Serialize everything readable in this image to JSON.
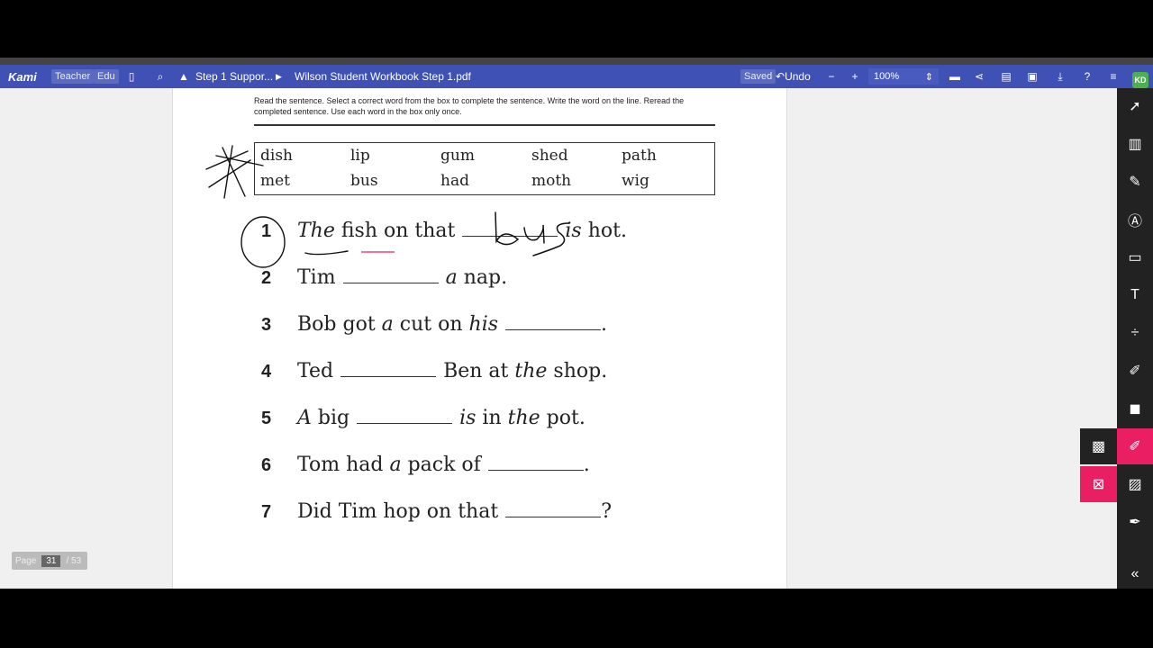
{
  "toolbar": {
    "logo": "Kami",
    "role_badge": "Teacher",
    "edu_badge": "Edu",
    "folder_crumb": "Step 1 Suppor...",
    "file_name": "Wilson Student Workbook Step 1.pdf",
    "saved_label": "Saved",
    "undo_label": "Undo",
    "zoom_value": "100%",
    "avatar_initials": "KD"
  },
  "document": {
    "instructions": "Read the sentence. Select a correct word from the box to complete the sentence. Write the word on the line. Reread the completed sentence. Use each word in the box only once.",
    "words_row1": [
      "dish",
      "lip",
      "gum",
      "shed",
      "path"
    ],
    "words_row2": [
      "met",
      "bus",
      "had",
      "moth",
      "wig"
    ],
    "sentences": [
      {
        "n": "1",
        "a": "The",
        "b": "fish on that",
        "c": "is",
        "d": "hot."
      },
      {
        "n": "2",
        "a": "Tim",
        "c": "a",
        "d": "nap."
      },
      {
        "n": "3",
        "a": "Bob got",
        "b": "a",
        "b2": "cut on",
        "b3": "his",
        "d": "."
      },
      {
        "n": "4",
        "a": "Ted",
        "b": "Ben at",
        "b2": "the",
        "d": "shop."
      },
      {
        "n": "5",
        "a": "A",
        "a2": "big",
        "b": "is",
        "b2": "in",
        "b3": "the",
        "d": "pot."
      },
      {
        "n": "6",
        "a": "Tom had",
        "b": "a",
        "b2": "pack of",
        "d": "."
      },
      {
        "n": "7",
        "a": "Did Tim hop on that",
        "d": "?"
      }
    ],
    "handwriting": "bus"
  },
  "pager": {
    "label": "Page",
    "current": "31",
    "total": "/ 53"
  },
  "colors": {
    "toolbar": "#3f51b5",
    "accent_pink": "#e91e63",
    "sidebar": "#222222"
  }
}
